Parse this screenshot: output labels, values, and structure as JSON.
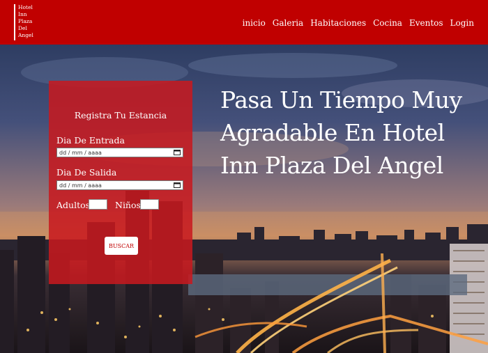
{
  "header": {
    "logo_lines": [
      "Hotel",
      "Inn",
      "Plaza",
      "Del",
      "Angel"
    ],
    "nav": [
      "inicio",
      "Galeria",
      "Habitaciones",
      "Cocina",
      "Eventos",
      "Login"
    ],
    "background_color": "#c00000"
  },
  "reservation": {
    "title": "Registra Tu Estancia",
    "checkin_label": "Dia De Entrada",
    "checkin_placeholder": "dd / mm / aaaa",
    "checkout_label": "Dia De Salida",
    "checkout_placeholder": "dd / mm / aaaa",
    "adults_label": "Adultos",
    "children_label": "Niños",
    "submit_label": "BUSCAR",
    "card_color": "#c8191e"
  },
  "hero": {
    "headline_lines": [
      "Pasa Un Tiempo Muy",
      "Agradable En Hotel",
      "Inn Plaza Del Angel"
    ],
    "background_image": "night city skyline with highway light trails"
  }
}
